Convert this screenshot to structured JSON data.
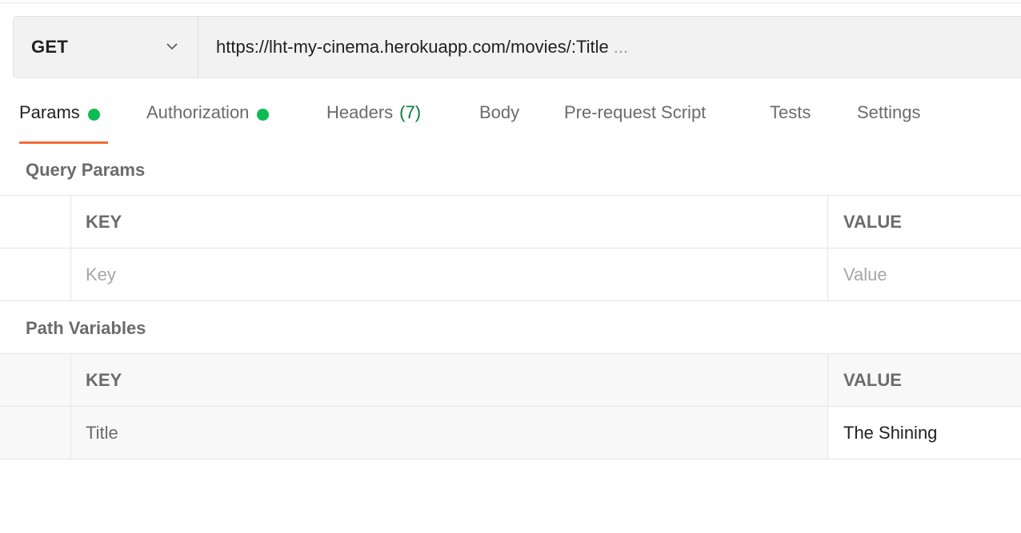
{
  "request": {
    "method": "GET",
    "url": "https://lht-my-cinema.herokuapp.com/movies/:Title",
    "url_overflow": "..."
  },
  "tabs": {
    "params": "Params",
    "authorization": "Authorization",
    "headers": "Headers",
    "headers_count": "(7)",
    "body": "Body",
    "prerequest": "Pre-request Script",
    "tests": "Tests",
    "settings": "Settings"
  },
  "query_params": {
    "title": "Query Params",
    "key_header": "KEY",
    "value_header": "VALUE",
    "key_placeholder": "Key",
    "value_placeholder": "Value"
  },
  "path_variables": {
    "title": "Path Variables",
    "key_header": "KEY",
    "value_header": "VALUE",
    "rows": [
      {
        "key": "Title",
        "value": "The Shining"
      }
    ]
  },
  "colors": {
    "active_tab_underline": "#f26b3a",
    "status_dot": "#0cbb52",
    "count_text": "#0a7a3c"
  }
}
